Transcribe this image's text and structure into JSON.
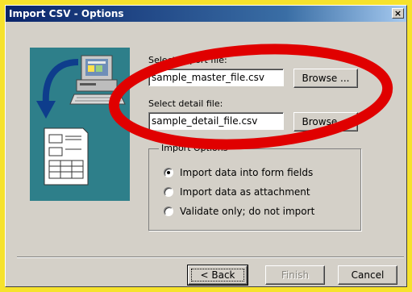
{
  "window": {
    "title": "Import CSV - Options",
    "close_glyph": "×"
  },
  "import_file": {
    "label": "Select import file:",
    "value": "sample_master_file.csv",
    "browse_label": "Browse ..."
  },
  "detail_file": {
    "label": "Select detail file:",
    "value": "sample_detail_file.csv",
    "browse_label": "Browse ..."
  },
  "import_options": {
    "title": "Import Options",
    "options": [
      {
        "label": "Import data into form fields",
        "checked": true
      },
      {
        "label": "Import data as attachment",
        "checked": false
      },
      {
        "label": "Validate only; do not import",
        "checked": false
      }
    ]
  },
  "buttons": {
    "back": "< Back",
    "finish": "Finish",
    "cancel": "Cancel"
  },
  "colors": {
    "background": "#f6e22c",
    "dialog": "#d4d0c8",
    "illustration": "#2e7f8a",
    "annotation_ring": "#e00000"
  },
  "icons": [
    "computer-icon",
    "curved-arrow-icon",
    "document-icon",
    "close-icon"
  ]
}
